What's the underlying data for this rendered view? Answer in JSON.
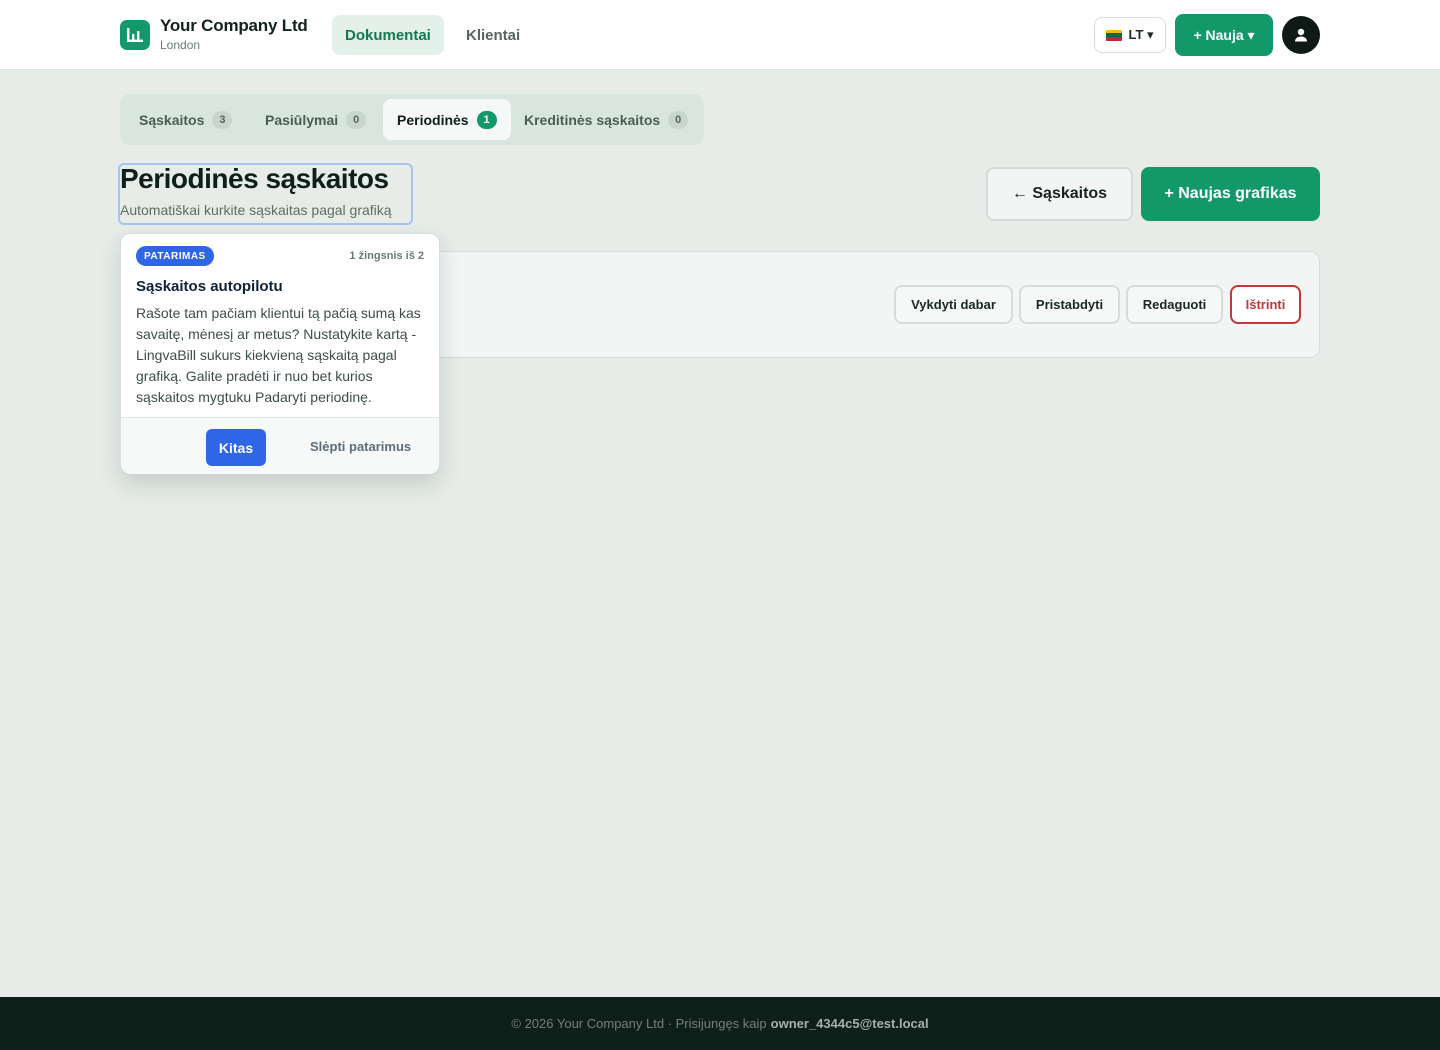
{
  "header": {
    "company_name": "Your Company Ltd",
    "company_city": "London",
    "nav": [
      {
        "label": "Dokumentai",
        "active": true
      },
      {
        "label": "Klientai",
        "active": false
      }
    ],
    "lang_label": "LT ▾",
    "new_label": "+ Nauja ▾",
    "accent_color": "#13986a"
  },
  "tabs": [
    {
      "label": "Sąskaitos",
      "count": "3",
      "active": false
    },
    {
      "label": "Pasiūlymai",
      "count": "0",
      "active": false
    },
    {
      "label": "Periodinės",
      "count": "1",
      "active": true
    },
    {
      "label": "Kreditinės sąskaitos",
      "count": "0",
      "active": false
    }
  ],
  "page": {
    "title": "Periodinės sąskaitos",
    "subtitle": "Automatiškai kurkite sąskaitas pagal grafiką",
    "back_label": "← Sąskaitos",
    "add_label": "+ Naujas grafikas"
  },
  "schedule_actions": {
    "run_now": "Vykdyti dabar",
    "pause": "Pristabdyti",
    "edit": "Redaguoti",
    "delete": "Ištrinti"
  },
  "tooltip": {
    "badge": "PATARIMAS",
    "step": "1 žingsnis iš 2",
    "title": "Sąskaitos autopilotu",
    "body": "Rašote tam pačiam klientui tą pačią sumą kas savaitę, mėnesį ar metus? Nustatykite kartą - LingvaBill sukurs kiekvieną sąskaitą pagal grafiką. Galite pradėti ir nuo bet kurios sąskaitos mygtuku Padaryti periodinę.",
    "next_label": "Kitas",
    "hide_label": "Slėpti patarimus",
    "accent_color": "#2f66e6"
  },
  "footer": {
    "text": "© 2026 Your Company Ltd · Prisijungęs kaip",
    "user": "owner_4344c5@test.local"
  }
}
